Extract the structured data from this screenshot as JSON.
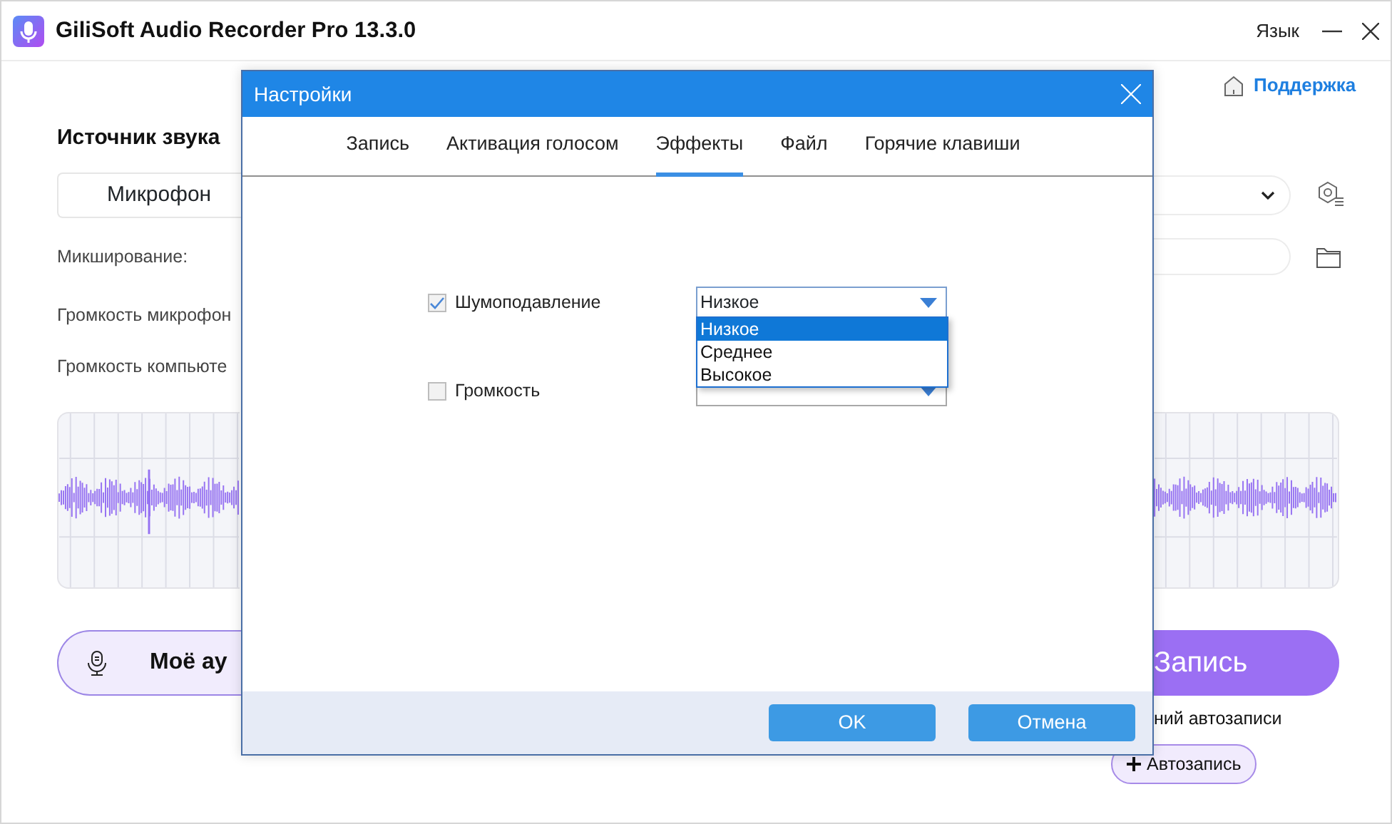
{
  "app": {
    "title": "GiliSoft Audio Recorder Pro 13.3.0",
    "language_menu": "Язык",
    "support_link": "Поддержка"
  },
  "main": {
    "source_heading": "Источник звука",
    "source_tab": "Микрофон",
    "mixing_label": "Микширование:",
    "mic_volume_label": "Громкость микрофон",
    "computer_volume_label": "Громкость компьюте",
    "my_audio_button": "Моё ау",
    "record_button": "Запись",
    "auto_text": "ний автозаписи",
    "auto_button": "Автозапись"
  },
  "dialog": {
    "title": "Настройки",
    "tabs": [
      {
        "label": "Запись",
        "selected": false
      },
      {
        "label": "Активация голосом",
        "selected": false
      },
      {
        "label": "Эффекты",
        "selected": true
      },
      {
        "label": "Файл",
        "selected": false
      },
      {
        "label": "Горячие клавиши",
        "selected": false
      }
    ],
    "options": [
      {
        "label": "Шумоподавление",
        "checked": true,
        "value": "Низкое",
        "expanded": true,
        "menu": [
          {
            "label": "Низкое",
            "selected": true
          },
          {
            "label": "Среднее",
            "selected": false
          },
          {
            "label": "Высокое",
            "selected": false
          }
        ]
      },
      {
        "label": "Громкость",
        "checked": false
      }
    ],
    "buttons": [
      "OK",
      "Отмена"
    ]
  }
}
